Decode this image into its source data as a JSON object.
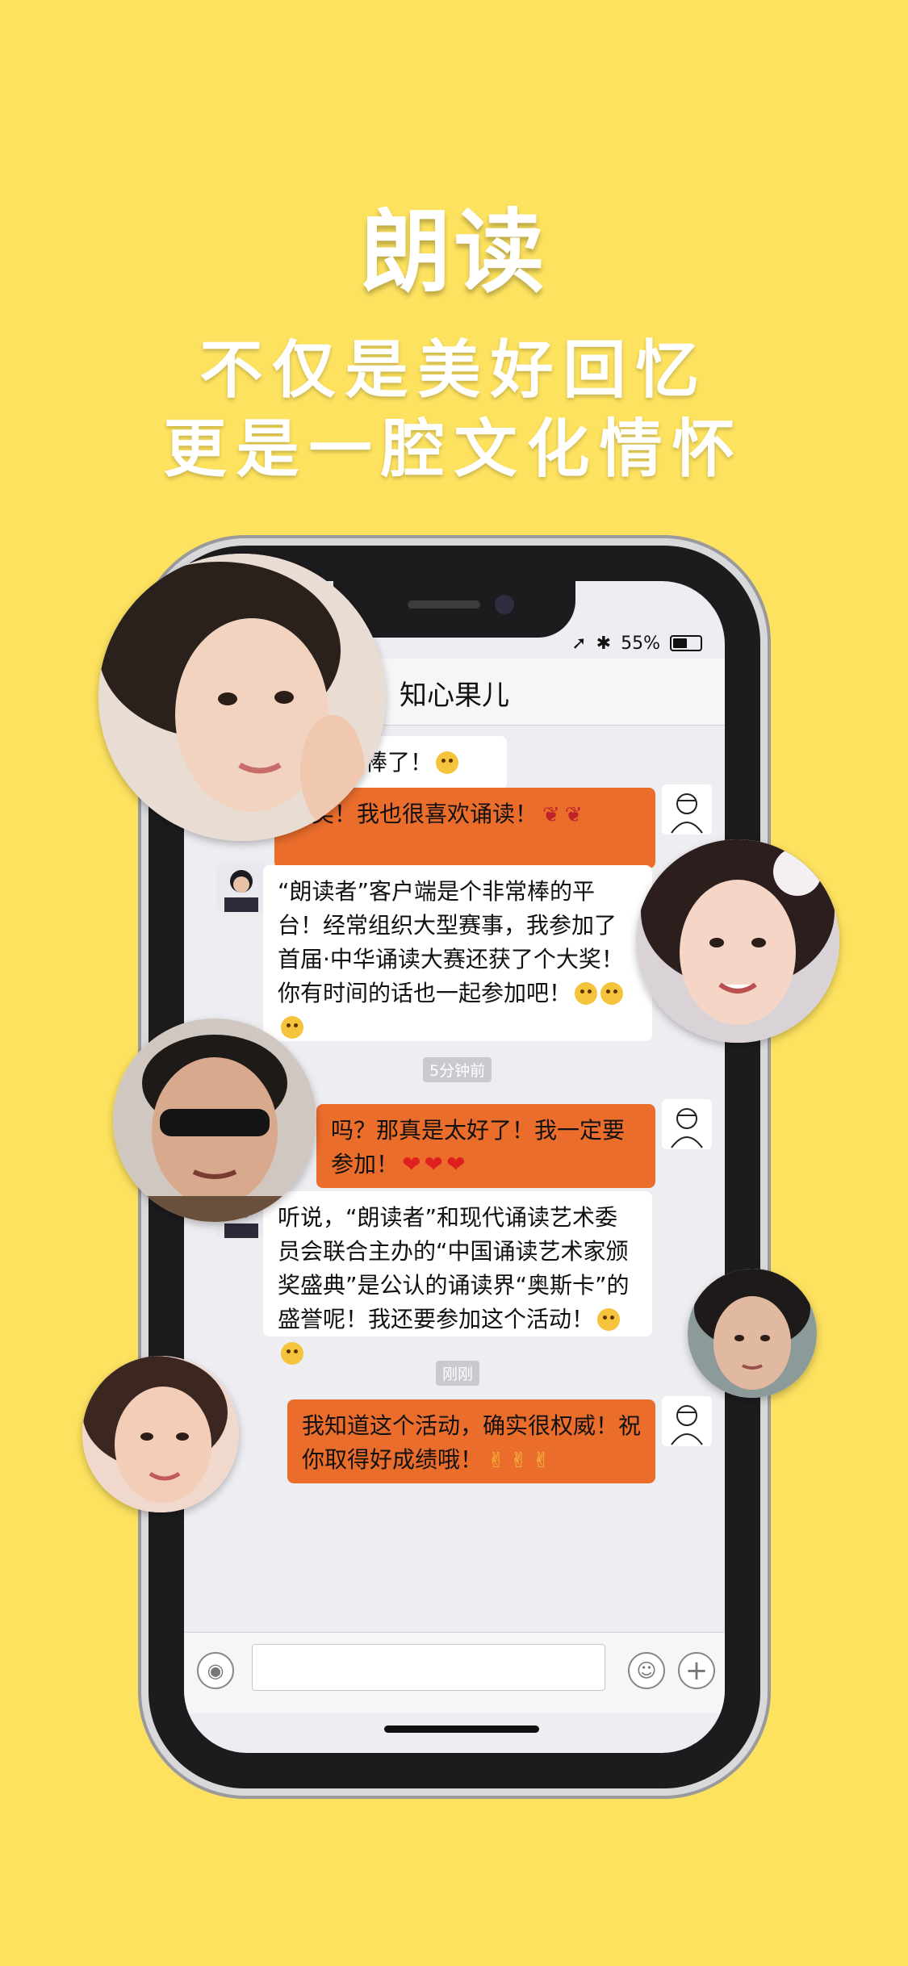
{
  "hero": {
    "title": "朗读",
    "subtitle_1": "不仅是美好回忆",
    "subtitle_2": "更是一腔文化情怀"
  },
  "status_bar": {
    "battery": "55%"
  },
  "chat": {
    "title": "知心果儿",
    "messages": [
      {
        "side": "left",
        "text": "是太棒了！"
      },
      {
        "side": "right",
        "text": "夸奖！我也很喜欢诵读！"
      },
      {
        "side": "left",
        "text": "“朗读者”客户端是个非常棒的平台！经常组织大型赛事，我参加了首届·中华诵读大赛还获了个大奖！你有时间的话也一起参加吧！"
      },
      {
        "side": "right",
        "text": "吗？那真是太好了！我一定要参加！"
      },
      {
        "side": "left",
        "text": "听说，“朗读者”和现代诵读艺术委员会联合主办的“中国诵读艺术家颁奖盛典”是公认的诵读界“奥斯卡”的盛誉呢！我还要参加这个活动！"
      },
      {
        "side": "right",
        "text": "我知道这个活动，确实很权威！祝你取得好成绩哦！"
      }
    ],
    "timestamps": [
      "5分钟前",
      "刚刚"
    ]
  },
  "colors": {
    "background": "#fde25f",
    "bubble_orange": "#ea6d2c"
  },
  "icons": [
    "voice-icon",
    "emoji-icon",
    "plus-icon"
  ]
}
